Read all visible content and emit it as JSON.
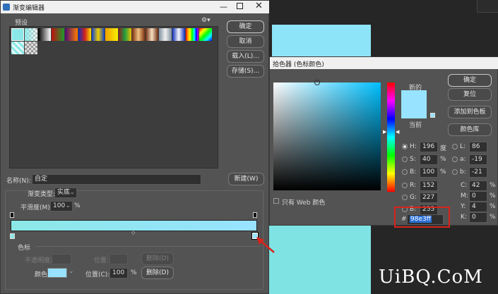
{
  "gradient_editor": {
    "title": "渐变编辑器",
    "presets_label": "预设",
    "buttons": {
      "ok": "确定",
      "cancel": "取消",
      "load": "载入(L)...",
      "save": "存储(S)...",
      "new": "新建(W)",
      "delete": "删除(D)",
      "delete_disabled": "删除(D)"
    },
    "name_label": "名称(N):",
    "name_value": "自定",
    "type_label": "渐变类型:",
    "type_value": "实底",
    "smooth_label": "平滑度(M):",
    "smooth_value": "100",
    "smooth_unit": "%",
    "stops_label": "色标",
    "opacity_label": "不透明度:",
    "location_label_disabled": "位置:",
    "color_label": "颜色:",
    "location_label": "位置(C):",
    "location_value": "100",
    "percent": "%",
    "gradient_start_color": "#8be8e6",
    "gradient_end_color": "#98e3ff"
  },
  "color_picker": {
    "title": "拾色器 (色标颜色)",
    "new_label": "新的",
    "current_label": "当前",
    "buttons": {
      "ok": "确定",
      "reset": "复位",
      "add_swatch": "添加到色板",
      "libraries": "颜色库"
    },
    "web_only_label": "只有 Web 颜色",
    "hsb": [
      {
        "label": "H:",
        "value": "196",
        "unit": "度"
      },
      {
        "label": "S:",
        "value": "40",
        "unit": "%"
      },
      {
        "label": "B:",
        "value": "100",
        "unit": "%"
      }
    ],
    "rgb": [
      {
        "label": "R:",
        "value": "152"
      },
      {
        "label": "G:",
        "value": "227"
      },
      {
        "label": "B:",
        "value": "255"
      }
    ],
    "lab": [
      {
        "label": "L:",
        "value": "86"
      },
      {
        "label": "a:",
        "value": "-19"
      },
      {
        "label": "b:",
        "value": "-21"
      }
    ],
    "cmyk": [
      {
        "label": "C:",
        "value": "42",
        "unit": "%"
      },
      {
        "label": "M:",
        "value": "0",
        "unit": "%"
      },
      {
        "label": "Y:",
        "value": "4",
        "unit": "%"
      },
      {
        "label": "K:",
        "value": "0",
        "unit": "%"
      }
    ],
    "hex_label": "#",
    "hex_value": "98e3ff",
    "new_color": "#98e3ff",
    "hue_base": "#00c0ff"
  },
  "watermark": "UiBQ.CoM",
  "colors": {
    "accent_red": "#d9231d",
    "canvas_light": "#8de4f8",
    "canvas_bottom": "#7fe3e4"
  }
}
